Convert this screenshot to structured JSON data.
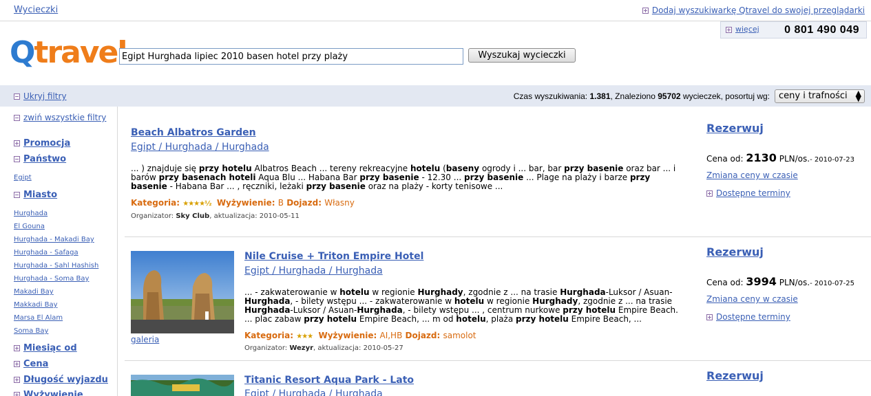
{
  "topbar": {
    "home_link": "Wycieczki",
    "add_search": "Dodaj wyszukiwarkę Qtravel do swojej przeglądarki"
  },
  "logo": {
    "q": "Q",
    "rest": "travel"
  },
  "search": {
    "value": "Egipt Hurghada lipiec 2010 basen hotel przy plaży",
    "button": "Wyszukaj wycieczki"
  },
  "phonebox": {
    "more": "więcej",
    "phone": "0 801 490 049"
  },
  "filterbar": {
    "hide_filters": "Ukryj filtry",
    "time_label": "Czas wyszukiwania:",
    "time_value": "1.381",
    "found_label": ", Znaleziono",
    "found_value": "95702",
    "found_suffix": "wycieczek, posortuj wg:",
    "sort_value": "ceny i trafności"
  },
  "sidebar": {
    "collapse_all": "zwiń wszystkie filtry",
    "promocja": "Promocja",
    "panstwo": "Państwo",
    "panstwo_items": [
      "Egipt"
    ],
    "miasto": "Miasto",
    "miasto_items": [
      "Hurghada",
      "El Gouna",
      "Hurghada - Makadi Bay",
      "Hurghada - Safaga",
      "Hurghada - Sahl Hashish",
      "Hurghada - Soma Bay",
      "Makadi Bay",
      "Makkadi Bay",
      "Marsa El Alam",
      "Soma Bay"
    ],
    "miesiac": "Miesiąc od",
    "cena": "Cena",
    "dlugosc": "Długość wyjazdu",
    "wyzywienie": "Wyżywienie"
  },
  "results": [
    {
      "title": "Beach Albatros Garden",
      "location": "Egipt / Hurghada / Hurghada",
      "snippet_html_parts": [
        "... ) znajduje się ",
        "przy hotelu",
        " Albatros Beach ... tereny rekreacyjne ",
        "hotelu",
        " (",
        "baseny",
        " ogrody i ... bar, bar ",
        "przy basenie",
        " oraz bar ... i barów ",
        "przy basenach hoteli",
        " Aqua Blu ... Habana Bar ",
        "przy basenie",
        " - 12.30 ... ",
        "przy basenie",
        " ... Plage na plaży i barze ",
        "przy basenie",
        " - Habana Bar ... , ręczniki, leżaki ",
        "przy basenie",
        " oraz na plaży - korty tenisowe ..."
      ],
      "kategoria_label": "Kategoria:",
      "stars": "★★★★½",
      "wyzywienie_label": "Wyżywienie:",
      "wyzywienie": "B",
      "dojazd_label": "Dojazd:",
      "dojazd": "Własny",
      "organizer_label": "Organizator:",
      "organizer": "Sky Club",
      "update": ", aktualizacja: 2010-05-11",
      "book": "Rezerwuj",
      "price_label": "Cena od:",
      "price": "2130",
      "price_unit": "PLN/os.",
      "price_date": "- 2010-07-23",
      "price_changes": "Zmiana ceny w czasie",
      "dates": "Dostępne terminy"
    },
    {
      "title": "Nile Cruise + Triton Empire Hotel",
      "location": "Egipt / Hurghada / Hurghada",
      "gallery": "galeria",
      "kategoria_label": "Kategoria:",
      "stars": "★★★",
      "wyzywienie_label": "Wyżywienie:",
      "wyzywienie": "AI,HB",
      "dojazd_label": "Dojazd:",
      "dojazd": "samolot",
      "organizer_label": "Organizator:",
      "organizer": "Wezyr",
      "update": ", aktualizacja: 2010-05-27",
      "book": "Rezerwuj",
      "price_label": "Cena od:",
      "price": "3994",
      "price_unit": "PLN/os.",
      "price_date": "- 2010-07-25",
      "price_changes": "Zmiana ceny w czasie",
      "dates": "Dostępne terminy"
    },
    {
      "title": "Titanic Resort Aqua Park - Lato",
      "location": "Egipt / Hurghada / Hurghada",
      "book": "Rezerwuj"
    }
  ],
  "colors": {
    "link": "#3a5fb5",
    "orange": "#d86b10",
    "logo_blue": "#2d7bd0",
    "logo_orange": "#ef7d1a",
    "filterbar_bg": "#e3e8f2"
  }
}
